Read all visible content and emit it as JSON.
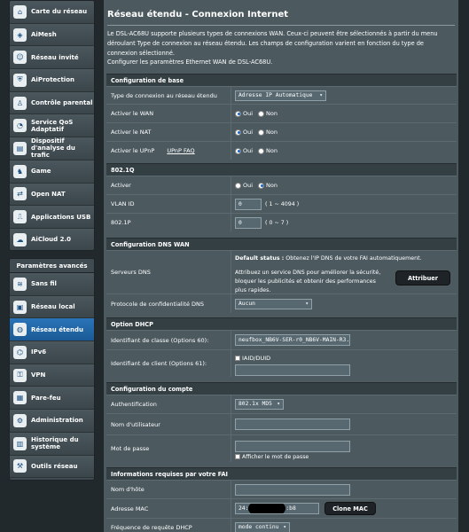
{
  "sidebar": {
    "group1": [
      {
        "label": "Carte du réseau",
        "icon": "map-icon"
      },
      {
        "label": "AiMesh",
        "icon": "mesh-icon"
      },
      {
        "label": "Réseau invité",
        "icon": "guest-icon"
      },
      {
        "label": "AiProtection",
        "icon": "shield-icon"
      },
      {
        "label": "Contrôle parental",
        "icon": "parental-icon"
      },
      {
        "label": "Service QoS Adaptatif",
        "icon": "qos-icon"
      },
      {
        "label": "Dispositif d'analyse du trafic",
        "icon": "traffic-icon"
      },
      {
        "label": "Game",
        "icon": "game-icon"
      },
      {
        "label": "Open NAT",
        "icon": "nat-icon"
      },
      {
        "label": "Applications USB",
        "icon": "usb-icon"
      },
      {
        "label": "AiCloud 2.0",
        "icon": "cloud-icon"
      }
    ],
    "advanced_title": "Paramètres avancés",
    "group2": [
      {
        "label": "Sans fil",
        "icon": "wireless-icon"
      },
      {
        "label": "Réseau local",
        "icon": "lan-icon"
      },
      {
        "label": "Réseau étendu",
        "icon": "wan-icon",
        "active": true
      },
      {
        "label": "IPv6",
        "icon": "ipv6-icon"
      },
      {
        "label": "VPN",
        "icon": "vpn-icon"
      },
      {
        "label": "Pare-feu",
        "icon": "firewall-icon"
      },
      {
        "label": "Administration",
        "icon": "admin-icon"
      },
      {
        "label": "Historique du système",
        "icon": "log-icon"
      },
      {
        "label": "Outils réseau",
        "icon": "tools-icon"
      }
    ]
  },
  "main": {
    "title": "Réseau étendu - Connexion Internet",
    "description": "Le DSL-AC68U supporte plusieurs types de connexions WAN. Ceux-ci peuvent être sélectionnés à partir du menu déroulant Type de connexion au réseau étendu. Les champs de configuration varient en fonction du type de connexion sélectionné.",
    "subtitle": "Configurer les paramètres Ethernet WAN de DSL-AC68U.",
    "basic": {
      "title": "Configuration de base",
      "conn_type_label": "Type de connexion au réseau étendu",
      "conn_type_value": "Adresse IP Automatique",
      "wan_label": "Activer le WAN",
      "nat_label": "Activer le NAT",
      "upnp_label": "Activer le UPnP",
      "upnp_faq": "UPnP FAQ",
      "oui": "Oui",
      "non": "Non"
    },
    "vlan": {
      "title": "802.1Q",
      "enable_label": "Activer",
      "vlanid_label": "VLAN ID",
      "vlanid_value": "0",
      "vlanid_hint": "( 1 ~ 4094 )",
      "p_label": "802.1P",
      "p_value": "0",
      "p_hint": "( 0 ~ 7 )",
      "oui": "Oui",
      "non": "Non"
    },
    "dns": {
      "title": "Configuration DNS WAN",
      "servers_label": "Serveurs DNS",
      "default_status_bold": "Default status :",
      "default_status_text": " Obtenez l'IP DNS de votre FAI automatiquement.",
      "recommend_text": "Attribuez un service DNS pour améliorer la sécurité, bloquer les publicités et obtenir des performances plus rapides.",
      "assign_button": "Attribuer",
      "privacy_label": "Protocole de confidentialité DNS",
      "privacy_value": "Aucun"
    },
    "dhcp": {
      "title": "Option DHCP",
      "class_label": "Identifiant de classe (Options 60):",
      "class_value": "neufbox_NB6V-SER-r0_NB6V-MAIN-R3.",
      "client_label": "Identifiant de client (Options 61):",
      "iaid_label": "IAID/DUID",
      "client_value": ""
    },
    "account": {
      "title": "Configuration du compte",
      "auth_label": "Authentification",
      "auth_value": "802.1x MD5",
      "user_label": "Nom d'utilisateur",
      "user_value": "",
      "pass_label": "Mot de passe",
      "pass_value": "",
      "show_pass_label": "Afficher le mot de passe"
    },
    "isp": {
      "title": "Informations requises par votre FAI",
      "host_label": "Nom d'hôte",
      "host_value": "",
      "mac_label": "Adresse MAC",
      "mac_prefix": "24:",
      "mac_suffix": ":b8",
      "clone_button": "Clone MAC",
      "dhcp_freq_label": "Fréquence de requête DHCP",
      "dhcp_freq_value": "mode continu"
    }
  }
}
